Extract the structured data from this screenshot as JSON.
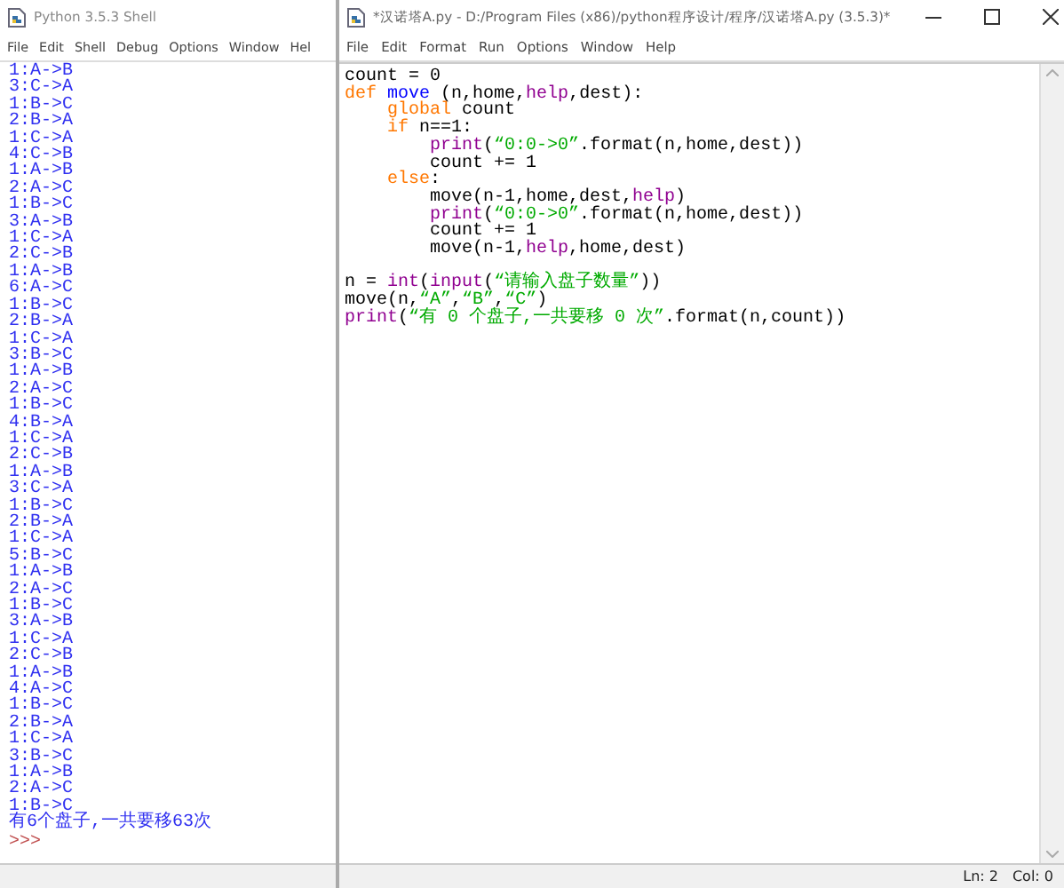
{
  "shell": {
    "title": "Python 3.5.3 Shell",
    "menu": [
      "File",
      "Edit",
      "Shell",
      "Debug",
      "Options",
      "Window",
      "Hel"
    ],
    "output": [
      "1:A->B",
      "3:C->A",
      "1:B->C",
      "2:B->A",
      "1:C->A",
      "4:C->B",
      "1:A->B",
      "2:A->C",
      "1:B->C",
      "3:A->B",
      "1:C->A",
      "2:C->B",
      "1:A->B",
      "6:A->C",
      "1:B->C",
      "2:B->A",
      "1:C->A",
      "3:B->C",
      "1:A->B",
      "2:A->C",
      "1:B->C",
      "4:B->A",
      "1:C->A",
      "2:C->B",
      "1:A->B",
      "3:C->A",
      "1:B->C",
      "2:B->A",
      "1:C->A",
      "5:B->C",
      "1:A->B",
      "2:A->C",
      "1:B->C",
      "3:A->B",
      "1:C->A",
      "2:C->B",
      "1:A->B",
      "4:A->C",
      "1:B->C",
      "2:B->A",
      "1:C->A",
      "3:B->C",
      "1:A->B",
      "2:A->C",
      "1:B->C",
      "有6个盘子,一共要移63次"
    ],
    "prompt": ">>>"
  },
  "editor": {
    "title": "*汉诺塔A.py - D:/Program Files (x86)/python程序设计/程序/汉诺塔A.py (3.5.3)*",
    "menu": [
      "File",
      "Edit",
      "Format",
      "Run",
      "Options",
      "Window",
      "Help"
    ],
    "lines": [
      {
        "kind": "code",
        "tokens": [
          {
            "kind": "plain",
            "text": "count = 0"
          }
        ]
      },
      {
        "kind": "code",
        "tokens": [
          {
            "kind": "keyword",
            "text": "def "
          },
          {
            "kind": "name",
            "text": "move"
          },
          {
            "kind": "plain",
            "text": " (n,home,"
          },
          {
            "kind": "builtin",
            "text": "help"
          },
          {
            "kind": "plain",
            "text": ",dest):"
          }
        ]
      },
      {
        "kind": "code",
        "tokens": [
          {
            "kind": "keyword",
            "text": "    global"
          },
          {
            "kind": "plain",
            "text": " count"
          }
        ]
      },
      {
        "kind": "code",
        "tokens": [
          {
            "kind": "keyword",
            "text": "    if"
          },
          {
            "kind": "plain",
            "text": " n==1:"
          }
        ]
      },
      {
        "kind": "code",
        "tokens": [
          {
            "kind": "builtin",
            "text": "        print"
          },
          {
            "kind": "plain",
            "text": "("
          },
          {
            "kind": "string",
            "text": "“0:0->0”"
          },
          {
            "kind": "plain",
            "text": ".format(n,home,dest))"
          }
        ]
      },
      {
        "kind": "code",
        "tokens": [
          {
            "kind": "plain",
            "text": "        count += 1"
          }
        ]
      },
      {
        "kind": "code",
        "tokens": [
          {
            "kind": "keyword",
            "text": "    else"
          },
          {
            "kind": "plain",
            "text": ":"
          }
        ]
      },
      {
        "kind": "code",
        "tokens": [
          {
            "kind": "plain",
            "text": "        move(n-1,home,dest,"
          },
          {
            "kind": "builtin",
            "text": "help"
          },
          {
            "kind": "plain",
            "text": ")"
          }
        ]
      },
      {
        "kind": "code",
        "tokens": [
          {
            "kind": "builtin",
            "text": "        print"
          },
          {
            "kind": "plain",
            "text": "("
          },
          {
            "kind": "string",
            "text": "“0:0->0”"
          },
          {
            "kind": "plain",
            "text": ".format(n,home,dest))"
          }
        ]
      },
      {
        "kind": "code",
        "tokens": [
          {
            "kind": "plain",
            "text": "        count += 1"
          }
        ]
      },
      {
        "kind": "code",
        "tokens": [
          {
            "kind": "plain",
            "text": "        move(n-1,"
          },
          {
            "kind": "builtin",
            "text": "help"
          },
          {
            "kind": "plain",
            "text": ",home,dest)"
          }
        ]
      },
      {
        "kind": "blank"
      },
      {
        "kind": "code",
        "tokens": [
          {
            "kind": "plain",
            "text": "n = "
          },
          {
            "kind": "builtin",
            "text": "int"
          },
          {
            "kind": "plain",
            "text": "("
          },
          {
            "kind": "builtin",
            "text": "input"
          },
          {
            "kind": "plain",
            "text": "("
          },
          {
            "kind": "string",
            "text": "“请输入盘子数量”"
          },
          {
            "kind": "plain",
            "text": "))"
          }
        ]
      },
      {
        "kind": "code",
        "tokens": [
          {
            "kind": "plain",
            "text": "move(n,"
          },
          {
            "kind": "string",
            "text": "“A”"
          },
          {
            "kind": "plain",
            "text": ","
          },
          {
            "kind": "string",
            "text": "“B”"
          },
          {
            "kind": "plain",
            "text": ","
          },
          {
            "kind": "string",
            "text": "“C”"
          },
          {
            "kind": "plain",
            "text": ")"
          }
        ]
      },
      {
        "kind": "code",
        "tokens": [
          {
            "kind": "builtin",
            "text": "print"
          },
          {
            "kind": "plain",
            "text": "("
          },
          {
            "kind": "string",
            "text": "“有 0 个盘子,一共要移 0 次”"
          },
          {
            "kind": "plain",
            "text": ".format(n,count))"
          }
        ]
      }
    ],
    "status": [
      "Ln: 2",
      "Col: 0"
    ]
  }
}
